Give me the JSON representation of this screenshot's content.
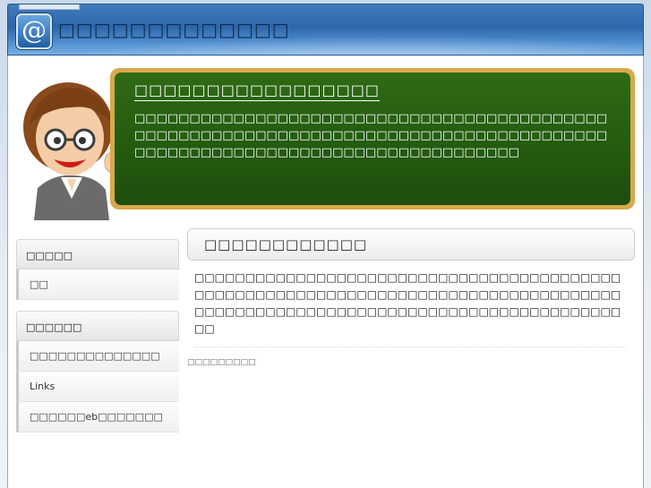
{
  "header": {
    "logo_glyph": "@",
    "title": "□□□□□□□□□□□□□"
  },
  "board": {
    "title": "□□□□□□□□□□□□□□□□□",
    "text": "□□□□□□□□□□□□□□□□□□□□□□□□□□□□□□□□□□□□□□□□□□□□□□□□□□□□□□□□□□□□□□□□□□□□□□□□□□□□□□□□□□□□□□□□□□□□□□□□□□□□□□□□□□□□□□□□□□□□□□□□□"
  },
  "sidebar": {
    "sections": [
      {
        "heading": "□□□□□",
        "items": [
          "□□"
        ]
      },
      {
        "heading": "□□□□□□",
        "items": [
          "□□□□□□□□□□□□□□",
          "Links",
          "□□□□□□eb□□□□□□□"
        ]
      }
    ]
  },
  "main": {
    "heading": "□□□□□□□□□□□□",
    "text": "□□□□□□□□□□□□□□□□□□□□□□□□□□□□□□□□□□□□□□□□□□□□□□□□□□□□□□□□□□□□□□□□□□□□□□□□□□□□□□□□□□□□□□□□□□□□□□□□□□□□□□□□□□□□□□□□□□□□□□□□□□□□□□□□",
    "footnote": "□□□□□□□□□"
  },
  "colors": {
    "header_blue": "#2d67a9",
    "board_green": "#235a10",
    "board_frame": "#d9a94a"
  }
}
